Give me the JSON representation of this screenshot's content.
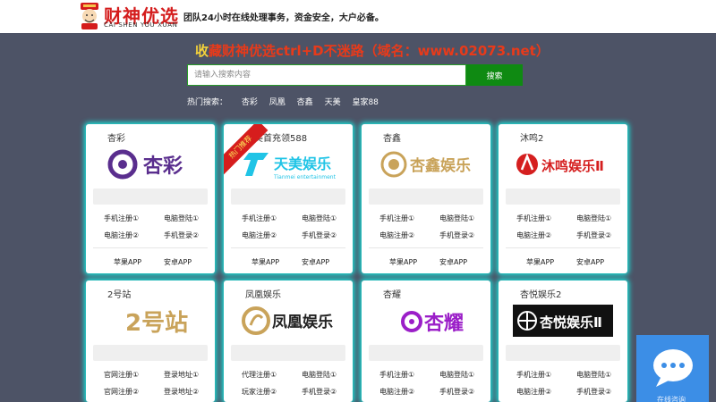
{
  "header": {
    "logo_title": "财神优选",
    "logo_subtitle": "CAI SHEN YOU XUAN",
    "tagline": "团队24小时在线处理事务，资金安全，大户必备。"
  },
  "banner": {
    "first_char": "收",
    "rest": "藏财神优选ctrl+D不迷路（域名：www.02073.net）"
  },
  "search": {
    "placeholder": "请输入搜索内容",
    "button": "搜索"
  },
  "hot_search": {
    "label": "热门搜索：",
    "items": [
      "杏彩",
      "凤凰",
      "杏鑫",
      "天美",
      "皇家88"
    ]
  },
  "cards": [
    {
      "name": "杏彩",
      "logo_text": "杏彩",
      "logo_color": "#5a2e8e",
      "links": [
        "手机注册①",
        "电脑登陆①",
        "电脑注册②",
        "手机登录②"
      ],
      "apps": [
        "苹果APP",
        "安卓APP"
      ]
    },
    {
      "name": "天美首充领588",
      "logo_text": "天美娱乐",
      "logo_sub": "Tianmei entertainment",
      "logo_color": "#20c4e6",
      "ribbon": "热门推荐",
      "links": [
        "手机注册①",
        "电脑登陆①",
        "电脑注册②",
        "手机登录②"
      ],
      "apps": [
        "苹果APP",
        "安卓APP"
      ]
    },
    {
      "name": "杏鑫",
      "logo_text": "杏鑫娱乐",
      "logo_color": "#c9a35a",
      "links": [
        "手机注册①",
        "电脑登陆①",
        "电脑注册②",
        "手机登录②"
      ],
      "apps": [
        "苹果APP",
        "安卓APP"
      ]
    },
    {
      "name": "沐鸣2",
      "logo_text": "沐鸣娱乐Ⅱ",
      "logo_color": "#d51f1f",
      "links": [
        "手机注册①",
        "电脑登陆①",
        "电脑注册②",
        "手机登录②"
      ],
      "apps": [
        "苹果APP",
        "安卓APP"
      ]
    },
    {
      "name": "2号站",
      "logo_text": "2号站",
      "logo_color": "#c9a35a",
      "links": [
        "官网注册①",
        "登录地址①",
        "官网注册②",
        "登录地址②"
      ]
    },
    {
      "name": "凤凰娱乐",
      "logo_text": "凤凰娱乐",
      "logo_color": "#222222",
      "links": [
        "代理注册①",
        "电脑登陆①",
        "玩家注册②",
        "手机登录②"
      ]
    },
    {
      "name": "杏耀",
      "logo_text": "杏耀",
      "logo_color": "#9b1fc8",
      "links": [
        "手机注册①",
        "电脑登陆①",
        "电脑注册②",
        "手机登录②"
      ]
    },
    {
      "name": "杏悦娱乐2",
      "logo_text": "杏悦娱乐Ⅱ",
      "logo_color": "#111111",
      "links": [
        "手机注册①",
        "电脑登陆①",
        "电脑注册②",
        "手机登录②"
      ]
    }
  ],
  "chat": {
    "label": "在线咨询"
  }
}
